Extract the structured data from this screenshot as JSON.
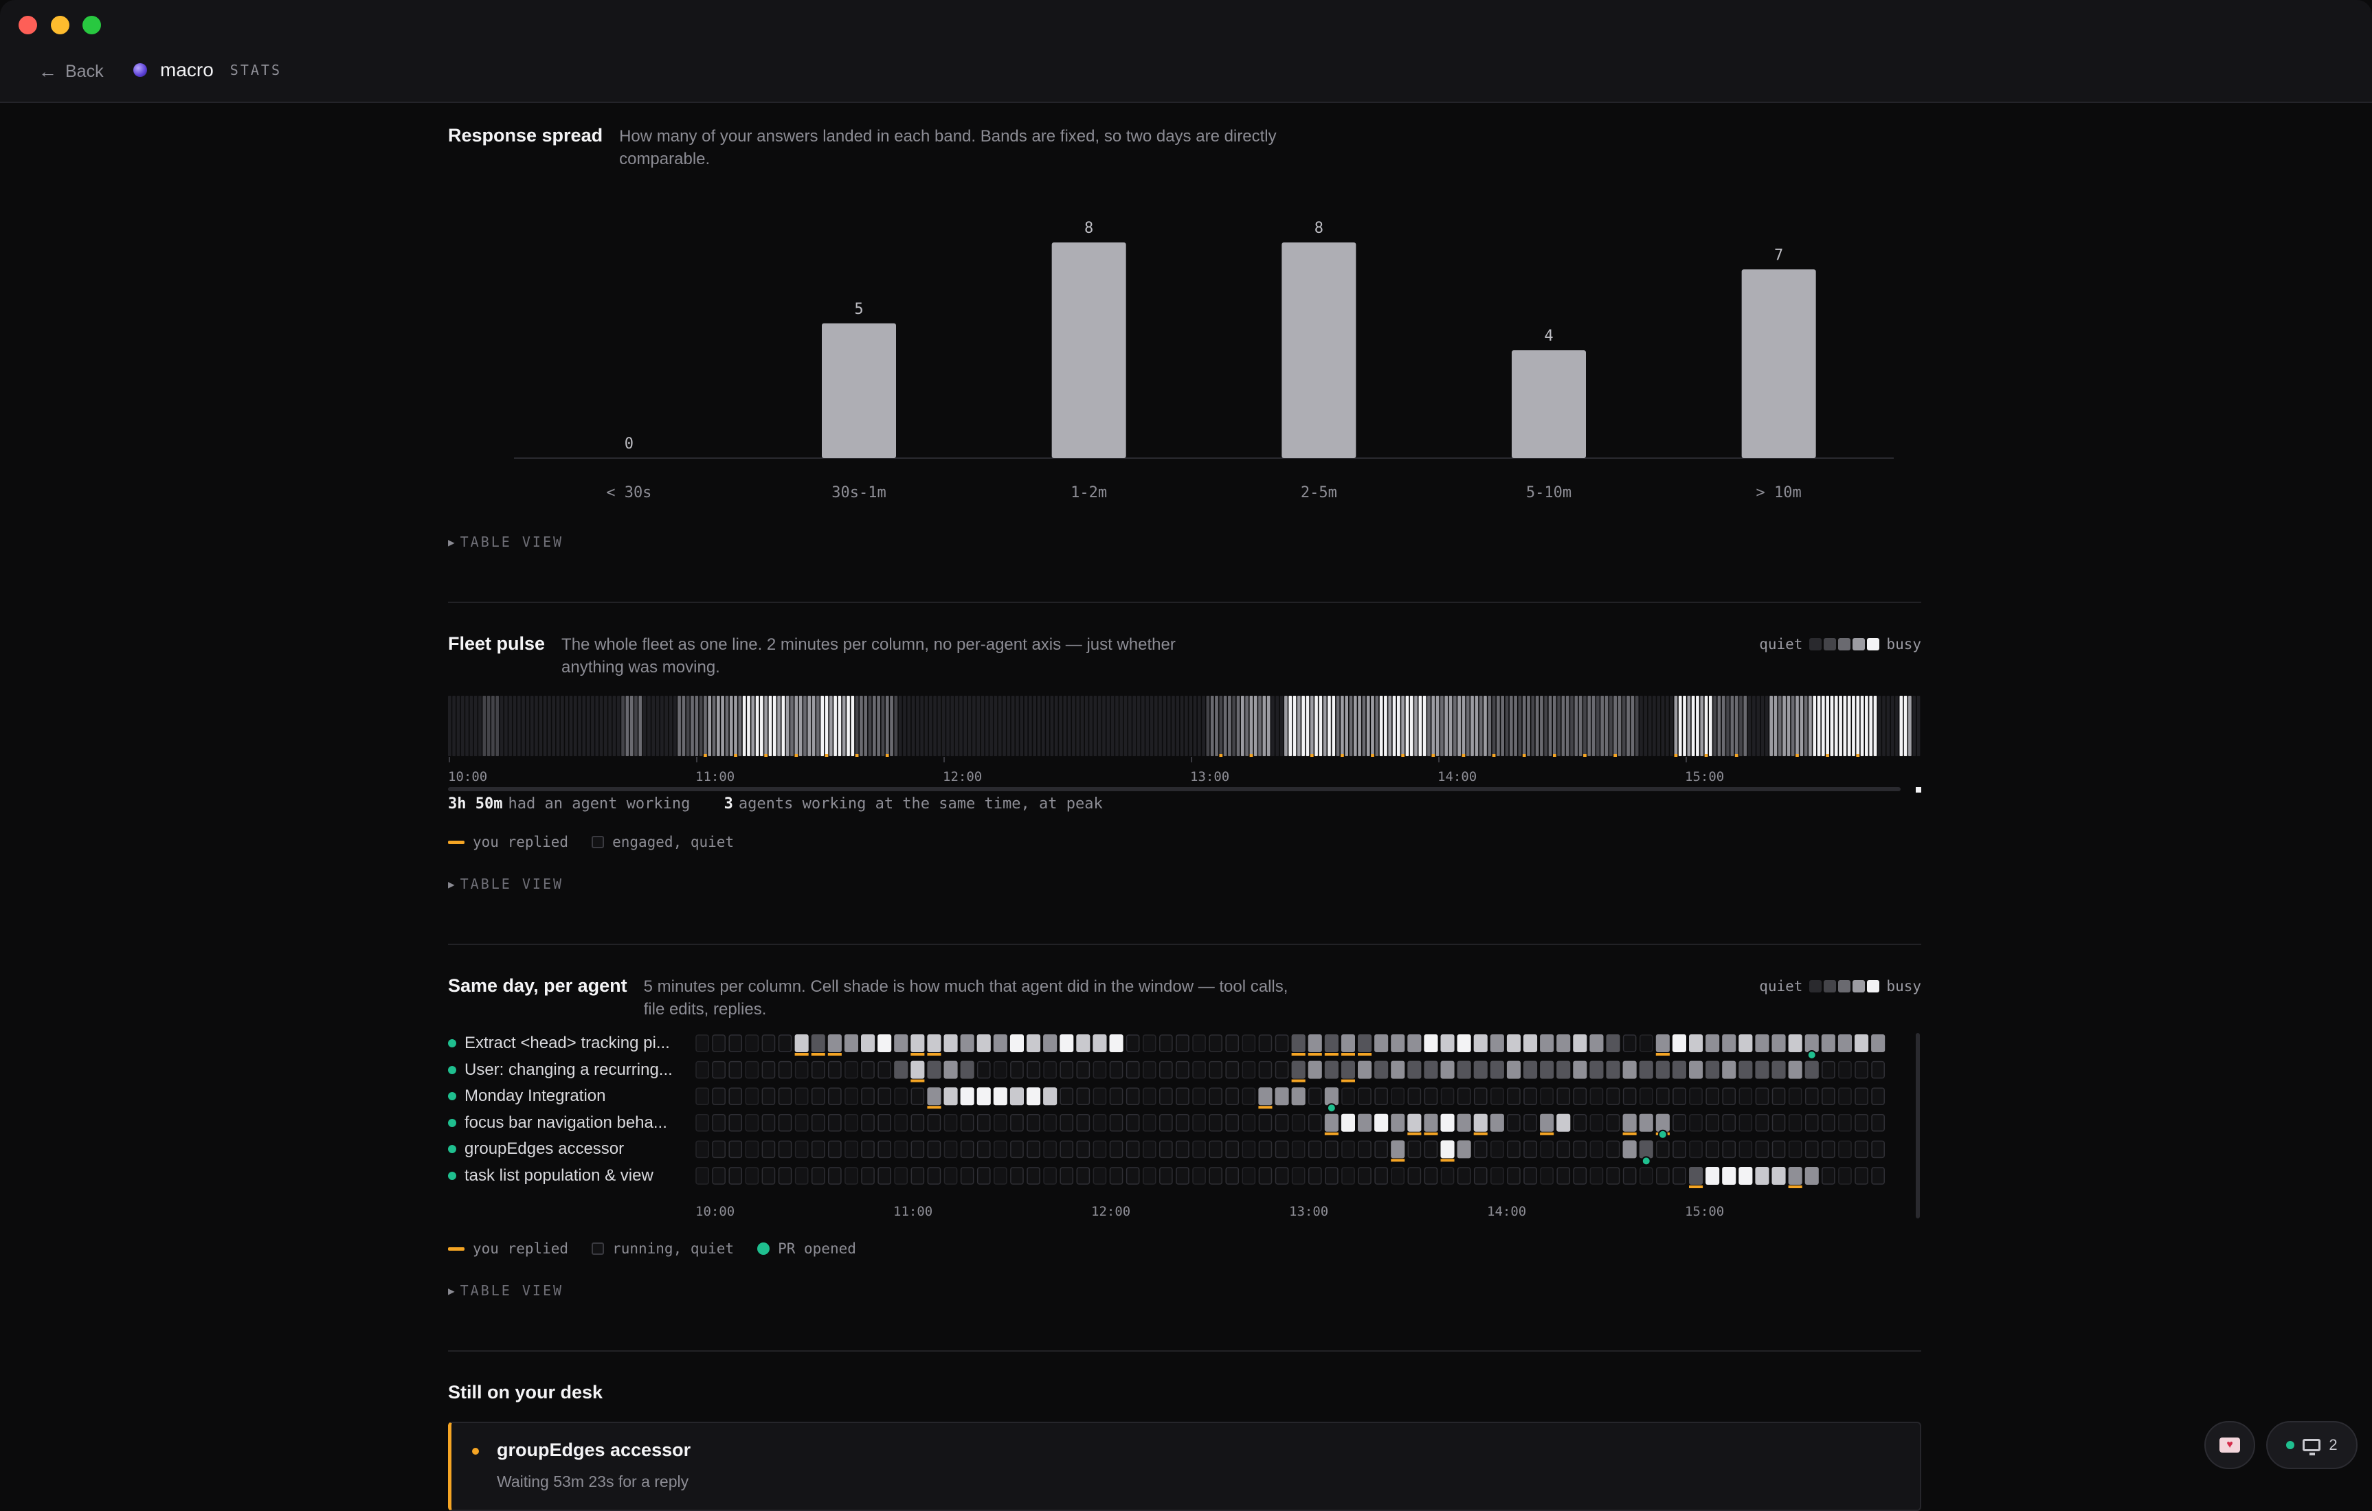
{
  "app": {
    "back_label": "Back",
    "name": "macro",
    "tag": "STATS"
  },
  "response_spread": {
    "title": "Response spread",
    "desc": "How many of your answers landed in each band. Bands are fixed, so two days are directly comparable.",
    "table_view": "TABLE VIEW"
  },
  "chart_data": {
    "type": "bar",
    "categories": [
      "< 30s",
      "30s-1m",
      "1-2m",
      "2-5m",
      "5-10m",
      "> 10m"
    ],
    "values": [
      0,
      5,
      8,
      8,
      4,
      7
    ],
    "ylim": [
      0,
      8
    ],
    "bar_color": "#aeaeb4"
  },
  "fleet": {
    "title": "Fleet pulse",
    "desc": "The whole fleet as one line. 2 minutes per column, no per-agent axis — just whether anything was moving.",
    "quiet": "quiet",
    "busy": "busy",
    "ticks": [
      "10:00",
      "11:00",
      "12:00",
      "13:00",
      "14:00",
      "15:00"
    ],
    "stat1_value": "3h 50m",
    "stat1_label": "had an agent working",
    "stat2_value": "3",
    "stat2_label": "agents working at the same time, at peak",
    "legend_replied": "you replied",
    "legend_quiet": "engaged, quiet",
    "table_view": "TABLE VIEW",
    "activity_segments": [
      [
        8,
        12,
        1
      ],
      [
        40,
        45,
        2
      ],
      [
        53,
        60,
        2
      ],
      [
        60,
        68,
        3
      ],
      [
        68,
        78,
        4
      ],
      [
        78,
        86,
        3
      ],
      [
        86,
        94,
        4
      ],
      [
        94,
        104,
        2
      ],
      [
        175,
        183,
        2
      ],
      [
        183,
        190,
        3
      ],
      [
        193,
        205,
        4
      ],
      [
        205,
        215,
        3
      ],
      [
        215,
        226,
        4
      ],
      [
        226,
        240,
        3
      ],
      [
        240,
        258,
        2
      ],
      [
        258,
        275,
        2
      ],
      [
        283,
        292,
        4
      ],
      [
        292,
        300,
        2
      ],
      [
        305,
        315,
        3
      ],
      [
        315,
        330,
        5
      ],
      [
        335,
        338,
        4
      ]
    ]
  },
  "per_agent": {
    "title": "Same day, per agent",
    "desc": "5 minutes per column. Cell shade is how much that agent did in the window — tool calls, file edits, replies.",
    "quiet": "quiet",
    "busy": "busy",
    "ticks": [
      "10:00",
      "11:00",
      "12:00",
      "13:00",
      "14:00",
      "15:00"
    ],
    "legend_replied": "you replied",
    "legend_quiet": "running, quiet",
    "legend_pr": "PR opened",
    "table_view": "TABLE VIEW",
    "agents": [
      {
        "name": "Extract <head> tracking pi...",
        "cells": [
          [
            6,
            4,
            4
          ],
          [
            7,
            2,
            3
          ],
          [
            8,
            3,
            3
          ],
          [
            9,
            3,
            4
          ],
          [
            10,
            4,
            2
          ],
          [
            11,
            5,
            3
          ],
          [
            12,
            3,
            3
          ],
          [
            13,
            4,
            2
          ],
          [
            14,
            4,
            3
          ],
          [
            15,
            4,
            3
          ],
          [
            16,
            3,
            2
          ],
          [
            17,
            4,
            3
          ],
          [
            18,
            3,
            3
          ],
          [
            19,
            5,
            2
          ],
          [
            20,
            4,
            3
          ],
          [
            21,
            3,
            3
          ],
          [
            22,
            5,
            3
          ],
          [
            23,
            4,
            4
          ],
          [
            24,
            4,
            2
          ],
          [
            25,
            5,
            2
          ],
          [
            36,
            2,
            4
          ],
          [
            37,
            3,
            3
          ],
          [
            38,
            2,
            4
          ],
          [
            39,
            3,
            2
          ],
          [
            40,
            2,
            4
          ],
          [
            41,
            3,
            3
          ],
          [
            42,
            3,
            2
          ],
          [
            43,
            3,
            4
          ],
          [
            44,
            5,
            2
          ],
          [
            45,
            4,
            3
          ],
          [
            46,
            5,
            2
          ],
          [
            47,
            4,
            3
          ],
          [
            48,
            3,
            4
          ],
          [
            49,
            4,
            3
          ],
          [
            50,
            4,
            2
          ],
          [
            51,
            3,
            3
          ],
          [
            52,
            3,
            2
          ],
          [
            53,
            4,
            2
          ],
          [
            54,
            3,
            3
          ],
          [
            55,
            2,
            3
          ],
          [
            58,
            3,
            4
          ],
          [
            59,
            5,
            2
          ],
          [
            60,
            4,
            3
          ],
          [
            61,
            3,
            3
          ],
          [
            62,
            3,
            2
          ],
          [
            63,
            4,
            3
          ],
          [
            64,
            3,
            3
          ],
          [
            65,
            3,
            2
          ],
          [
            66,
            4,
            3
          ],
          [
            67,
            3,
            2
          ],
          [
            68,
            3,
            3
          ],
          [
            69,
            3,
            2
          ],
          [
            70,
            4,
            2
          ],
          [
            71,
            3,
            3
          ],
          [
            72,
            3,
            2
          ],
          [
            73,
            4,
            3
          ],
          [
            74,
            4,
            2
          ],
          [
            75,
            3,
            3
          ],
          [
            76,
            3,
            2
          ],
          [
            77,
            4,
            3
          ],
          [
            78,
            3,
            2
          ],
          [
            79,
            3,
            3
          ],
          [
            80,
            4,
            2
          ],
          [
            81,
            3,
            3
          ],
          [
            82,
            3,
            2
          ],
          [
            83,
            4,
            3
          ],
          [
            84,
            3,
            3
          ],
          [
            85,
            4,
            3
          ],
          [
            86,
            4,
            3
          ],
          [
            87,
            3,
            2
          ]
        ],
        "replied": [
          6,
          7,
          8,
          13,
          14,
          36,
          37,
          38,
          39,
          40,
          58
        ],
        "pr": [
          67
        ]
      },
      {
        "name": "User: changing a recurring...",
        "cells": [
          [
            12,
            2,
            2
          ],
          [
            13,
            4,
            3
          ],
          [
            14,
            2,
            2
          ],
          [
            15,
            3,
            3
          ],
          [
            16,
            2,
            2
          ],
          [
            36,
            2,
            3
          ],
          [
            37,
            3,
            2
          ],
          [
            38,
            2,
            3
          ],
          [
            39,
            2,
            2
          ],
          [
            40,
            3,
            2
          ],
          [
            41,
            2,
            3
          ],
          [
            42,
            3,
            2
          ],
          [
            43,
            2,
            2
          ],
          [
            44,
            2,
            2
          ],
          [
            45,
            3,
            3
          ],
          [
            46,
            2,
            2
          ],
          [
            47,
            2,
            3
          ],
          [
            48,
            2,
            2
          ],
          [
            49,
            3,
            3
          ],
          [
            50,
            2,
            2
          ],
          [
            51,
            2,
            3
          ],
          [
            52,
            2,
            2
          ],
          [
            53,
            3,
            3
          ],
          [
            54,
            2,
            2
          ],
          [
            55,
            2,
            3
          ],
          [
            56,
            3,
            2
          ],
          [
            57,
            2,
            2
          ],
          [
            58,
            2,
            3
          ],
          [
            59,
            2,
            2
          ],
          [
            60,
            3,
            3
          ],
          [
            61,
            2,
            2
          ],
          [
            62,
            3,
            2
          ],
          [
            63,
            2,
            3
          ],
          [
            64,
            2,
            2
          ],
          [
            65,
            2,
            3
          ],
          [
            66,
            3,
            2
          ],
          [
            67,
            2,
            2
          ]
        ],
        "replied": [
          13,
          36,
          39
        ],
        "pr": []
      },
      {
        "name": "Monday Integration",
        "cells": [
          [
            14,
            3,
            3
          ],
          [
            15,
            4,
            3
          ],
          [
            16,
            5,
            3
          ],
          [
            17,
            5,
            2
          ],
          [
            18,
            5,
            3
          ],
          [
            19,
            4,
            3
          ],
          [
            20,
            5,
            2
          ],
          [
            21,
            4,
            3
          ],
          [
            34,
            3,
            2
          ],
          [
            35,
            3,
            3
          ],
          [
            36,
            3,
            2
          ],
          [
            38,
            3,
            3
          ]
        ],
        "replied": [
          14,
          34
        ],
        "pr": [
          38
        ]
      },
      {
        "name": "focus bar navigation beha...",
        "cells": [
          [
            38,
            3,
            3
          ],
          [
            39,
            5,
            2
          ],
          [
            40,
            3,
            3
          ],
          [
            41,
            5,
            2
          ],
          [
            42,
            3,
            2
          ],
          [
            43,
            4,
            3
          ],
          [
            44,
            3,
            3
          ],
          [
            45,
            5,
            2
          ],
          [
            46,
            3,
            3
          ],
          [
            47,
            4,
            2
          ],
          [
            48,
            3,
            3
          ],
          [
            51,
            3,
            2
          ],
          [
            52,
            4,
            3
          ],
          [
            56,
            3,
            2
          ],
          [
            57,
            3,
            3
          ],
          [
            58,
            3,
            2
          ]
        ],
        "replied": [
          38,
          43,
          44,
          47,
          51,
          56,
          58
        ],
        "pr": [
          58
        ]
      },
      {
        "name": "groupEdges accessor",
        "cells": [
          [
            42,
            3,
            3
          ],
          [
            45,
            5,
            2
          ],
          [
            46,
            3,
            3
          ],
          [
            56,
            3,
            2
          ],
          [
            57,
            2,
            3
          ]
        ],
        "replied": [
          42,
          45
        ],
        "pr": [
          57
        ]
      },
      {
        "name": "task list population & view",
        "cells": [
          [
            60,
            2,
            2
          ],
          [
            61,
            5,
            3
          ],
          [
            62,
            5,
            2
          ],
          [
            63,
            5,
            3
          ],
          [
            64,
            4,
            3
          ],
          [
            65,
            4,
            2
          ],
          [
            66,
            3,
            3
          ],
          [
            67,
            3,
            2
          ]
        ],
        "replied": [
          60,
          66
        ],
        "pr": []
      }
    ]
  },
  "desk": {
    "title": "Still on your desk",
    "card_title": "groupEdges accessor",
    "card_sub": "Waiting 53m 23s for a reply"
  },
  "fab": {
    "count": "2"
  },
  "colors": {
    "accent": "#f5a524",
    "pr": "#1fbf8f"
  }
}
